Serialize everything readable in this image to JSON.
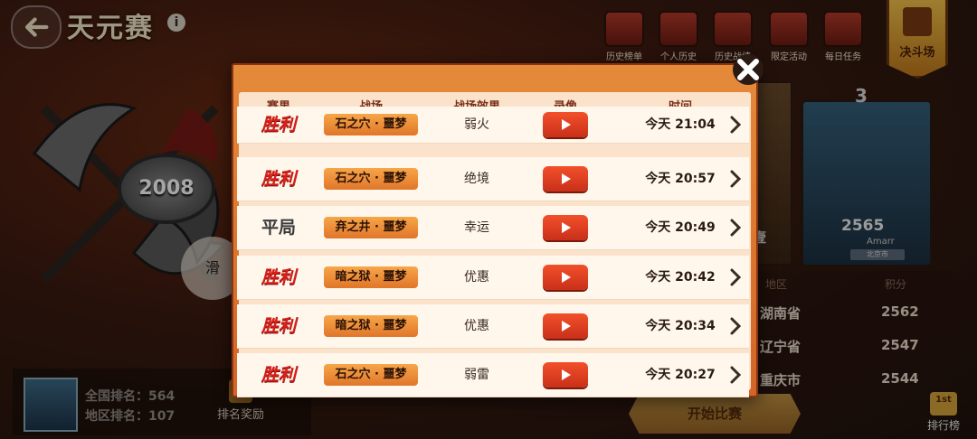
{
  "header": {
    "title": "天元赛",
    "info_icon": "i"
  },
  "top_nav": [
    {
      "label": "历史榜单",
      "icon": "trophy-icon"
    },
    {
      "label": "个人历史",
      "icon": "scroll-icon"
    },
    {
      "label": "历史战绩",
      "icon": "video-icon"
    },
    {
      "label": "限定活动",
      "icon": "event-icon"
    },
    {
      "label": "每日任务",
      "icon": "gift-icon"
    }
  ],
  "arena_button": {
    "label": "决斗场"
  },
  "emblem": {
    "score": "2008"
  },
  "swipe_hint": "滑",
  "player": {
    "national_rank": "全国排名：564",
    "region_rank": "地区排名：107",
    "reward_label": "排名奖励"
  },
  "featured": {
    "rank": "3",
    "score": "2565",
    "name": "Amarr",
    "place": "北京市",
    "side_text": "壹"
  },
  "leaderboard": {
    "col_region": "地区",
    "col_points": "积分",
    "rows": [
      {
        "region": "湖南省",
        "points": "2562"
      },
      {
        "region": "辽宁省",
        "points": "2547"
      },
      {
        "region": "重庆市",
        "points": "2544"
      }
    ]
  },
  "start_button": "开始比赛",
  "ranking_button": "排行榜",
  "ranking_badge": "1st",
  "modal": {
    "columns": {
      "result": "赛果",
      "field": "战场",
      "effect": "战场效果",
      "replay": "录像",
      "time": "时间"
    },
    "rows": [
      {
        "result": "胜利",
        "type": "win",
        "field": "石之穴 · 噩梦",
        "effect": "弱火",
        "time": "今天 21:04"
      },
      {
        "result": "胜利",
        "type": "win",
        "field": "石之穴 · 噩梦",
        "effect": "绝境",
        "time": "今天 20:57"
      },
      {
        "result": "平局",
        "type": "draw",
        "field": "弃之井 · 噩梦",
        "effect": "幸运",
        "time": "今天 20:49"
      },
      {
        "result": "胜利",
        "type": "win",
        "field": "暗之狱 · 噩梦",
        "effect": "优惠",
        "time": "今天 20:42"
      },
      {
        "result": "胜利",
        "type": "win",
        "field": "暗之狱 · 噩梦",
        "effect": "优惠",
        "time": "今天 20:34"
      },
      {
        "result": "胜利",
        "type": "win",
        "field": "石之穴 · 噩梦",
        "effect": "弱雷",
        "time": "今天 20:27"
      }
    ]
  },
  "colors": {
    "win": "#d6201a",
    "draw": "#3a3a3a",
    "accent": "#e0762a",
    "play": "#e0402a"
  }
}
